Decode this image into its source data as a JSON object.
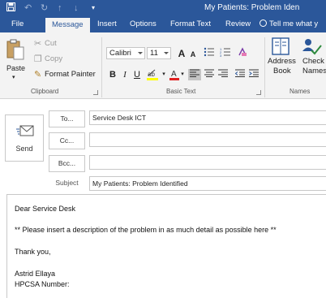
{
  "window": {
    "title": "My Patients: Problem Iden"
  },
  "quick_access": {
    "save_icon": "save-icon",
    "undo_icon": "undo-icon",
    "redo_icon": "redo-icon",
    "up_icon": "up-arrow-icon",
    "down_icon": "down-arrow-icon",
    "customize_icon": "customize-icon"
  },
  "tabs": [
    {
      "label": "File"
    },
    {
      "label": "Message"
    },
    {
      "label": "Insert"
    },
    {
      "label": "Options"
    },
    {
      "label": "Format Text"
    },
    {
      "label": "Review"
    },
    {
      "label": "Tell me what y"
    }
  ],
  "clipboard": {
    "paste": "Paste",
    "cut": "Cut",
    "copy": "Copy",
    "format_painter": "Format Painter",
    "group_label": "Clipboard"
  },
  "basic_text": {
    "font": "Calibri",
    "size": "11",
    "grow_font": "A",
    "shrink_font": "A",
    "bold": "B",
    "italic": "I",
    "underline": "U",
    "group_label": "Basic Text"
  },
  "names": {
    "address_line1": "Address",
    "address_line2": "Book",
    "check_line1": "Check",
    "check_line2": "Names",
    "group_label": "Names"
  },
  "compose": {
    "send_label": "Send",
    "to_button": "To...",
    "cc_button": "Cc...",
    "bcc_button": "Bcc...",
    "subject_label": "Subject",
    "to_value": "Service Desk ICT",
    "cc_value": "",
    "bcc_value": "",
    "subject_value": "My Patients: Problem Identified"
  },
  "body": {
    "greeting": "Dear Service Desk",
    "instruction": "** Please insert a description of the problem in as much detail as possible here **",
    "thanks": "Thank you,",
    "name": "Astrid Ellaya",
    "hpcsa": "HPCSA Number:"
  },
  "colors": {
    "accent": "#2b579a",
    "ribbon_bg": "#f3f3f3",
    "highlight_yellow": "#ffff00",
    "font_red": "#e02020"
  }
}
